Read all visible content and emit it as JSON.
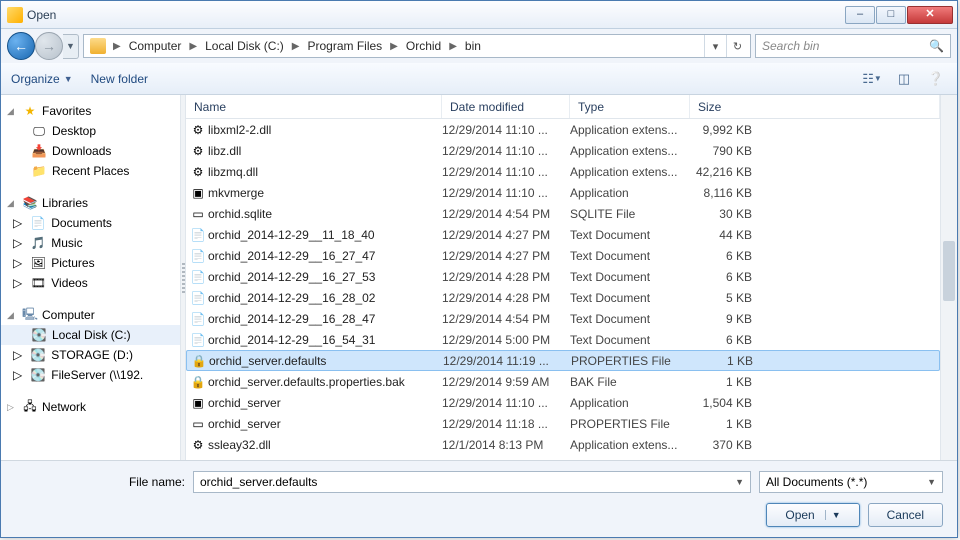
{
  "window": {
    "title": "Open"
  },
  "breadcrumb": {
    "segments": [
      "Computer",
      "Local Disk (C:)",
      "Program Files",
      "Orchid",
      "bin"
    ]
  },
  "search": {
    "placeholder": "Search bin"
  },
  "toolbar": {
    "organize": "Organize",
    "newfolder": "New folder"
  },
  "nav": {
    "favorites": {
      "label": "Favorites",
      "items": [
        "Desktop",
        "Downloads",
        "Recent Places"
      ]
    },
    "libraries": {
      "label": "Libraries",
      "items": [
        "Documents",
        "Music",
        "Pictures",
        "Videos"
      ]
    },
    "computer": {
      "label": "Computer",
      "items": [
        "Local Disk (C:)",
        "STORAGE (D:)",
        "FileServer (\\\\192."
      ]
    },
    "network": {
      "label": "Network"
    }
  },
  "columns": {
    "name": "Name",
    "date": "Date modified",
    "type": "Type",
    "size": "Size"
  },
  "files": [
    {
      "icon": "gear",
      "name": "libxml2-2.dll",
      "date": "12/29/2014 11:10 ...",
      "type": "Application extens...",
      "size": "9,992 KB"
    },
    {
      "icon": "gear",
      "name": "libz.dll",
      "date": "12/29/2014 11:10 ...",
      "type": "Application extens...",
      "size": "790 KB"
    },
    {
      "icon": "gear",
      "name": "libzmq.dll",
      "date": "12/29/2014 11:10 ...",
      "type": "Application extens...",
      "size": "42,216 KB"
    },
    {
      "icon": "app",
      "name": "mkvmerge",
      "date": "12/29/2014 11:10 ...",
      "type": "Application",
      "size": "8,116 KB"
    },
    {
      "icon": "file",
      "name": "orchid.sqlite",
      "date": "12/29/2014 4:54 PM",
      "type": "SQLITE File",
      "size": "30 KB"
    },
    {
      "icon": "txt",
      "name": "orchid_2014-12-29__11_18_40",
      "date": "12/29/2014 4:27 PM",
      "type": "Text Document",
      "size": "44 KB"
    },
    {
      "icon": "txt",
      "name": "orchid_2014-12-29__16_27_47",
      "date": "12/29/2014 4:27 PM",
      "type": "Text Document",
      "size": "6 KB"
    },
    {
      "icon": "txt",
      "name": "orchid_2014-12-29__16_27_53",
      "date": "12/29/2014 4:28 PM",
      "type": "Text Document",
      "size": "6 KB"
    },
    {
      "icon": "txt",
      "name": "orchid_2014-12-29__16_28_02",
      "date": "12/29/2014 4:28 PM",
      "type": "Text Document",
      "size": "5 KB"
    },
    {
      "icon": "txt",
      "name": "orchid_2014-12-29__16_28_47",
      "date": "12/29/2014 4:54 PM",
      "type": "Text Document",
      "size": "9 KB"
    },
    {
      "icon": "txt",
      "name": "orchid_2014-12-29__16_54_31",
      "date": "12/29/2014 5:00 PM",
      "type": "Text Document",
      "size": "6 KB"
    },
    {
      "icon": "lock",
      "name": "orchid_server.defaults",
      "date": "12/29/2014 11:19 ...",
      "type": "PROPERTIES File",
      "size": "1 KB",
      "selected": true
    },
    {
      "icon": "lock",
      "name": "orchid_server.defaults.properties.bak",
      "date": "12/29/2014 9:59 AM",
      "type": "BAK File",
      "size": "1 KB"
    },
    {
      "icon": "app",
      "name": "orchid_server",
      "date": "12/29/2014 11:10 ...",
      "type": "Application",
      "size": "1,504 KB"
    },
    {
      "icon": "file",
      "name": "orchid_server",
      "date": "12/29/2014 11:18 ...",
      "type": "PROPERTIES File",
      "size": "1 KB"
    },
    {
      "icon": "gear",
      "name": "ssleay32.dll",
      "date": "12/1/2014 8:13 PM",
      "type": "Application extens...",
      "size": "370 KB"
    }
  ],
  "filename": {
    "label": "File name:",
    "value": "orchid_server.defaults"
  },
  "filter": {
    "value": "All Documents (*.*)"
  },
  "buttons": {
    "open": "Open",
    "cancel": "Cancel"
  }
}
